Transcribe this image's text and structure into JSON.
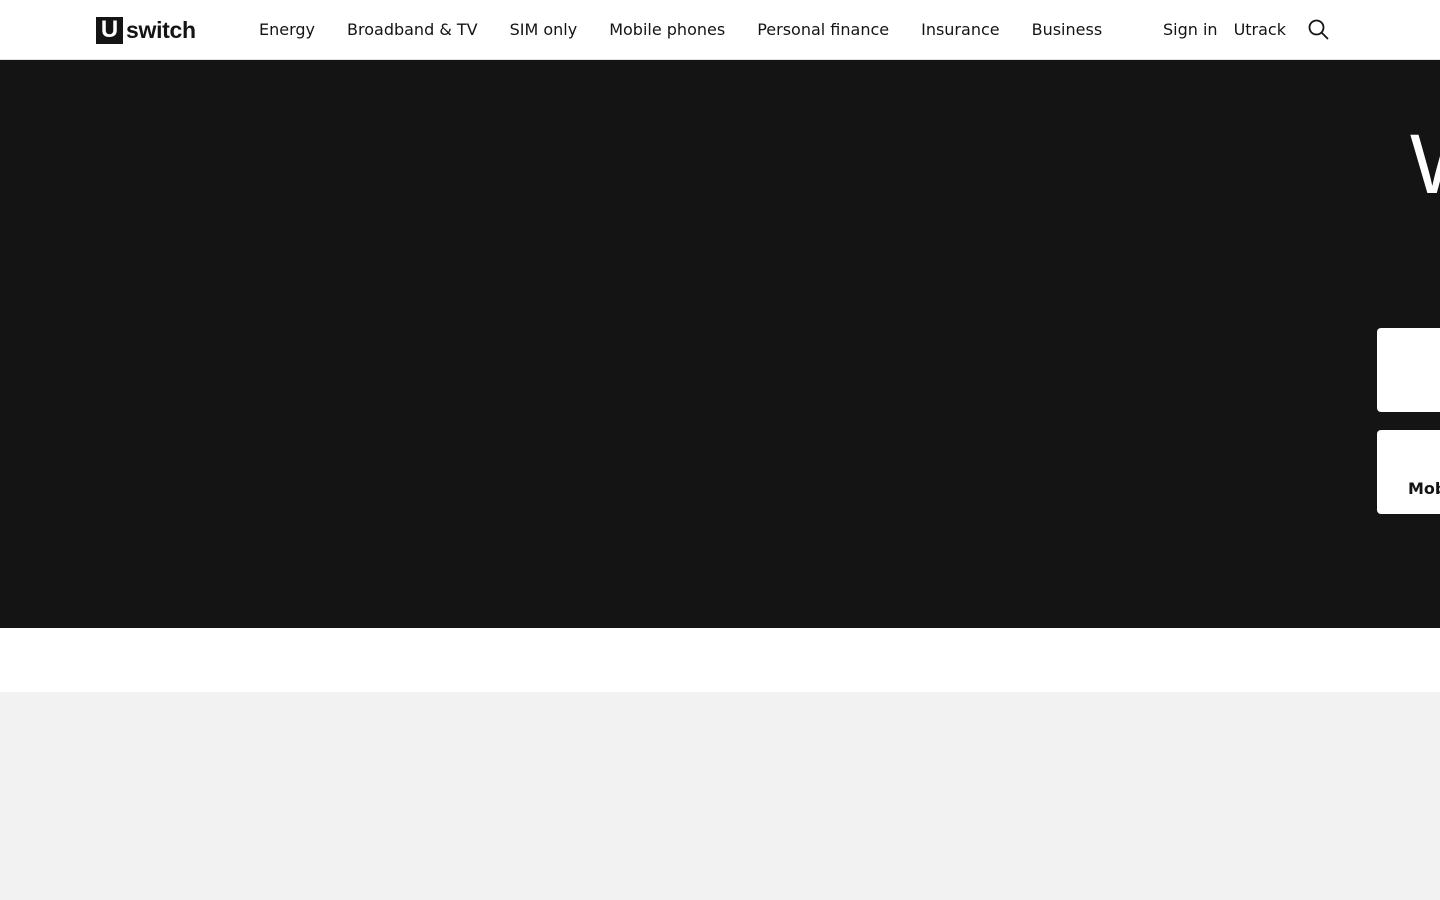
{
  "header": {
    "logo": {
      "mark": "U",
      "word": "switch"
    },
    "nav": [
      {
        "label": "Energy"
      },
      {
        "label": "Broadband & TV"
      },
      {
        "label": "SIM only"
      },
      {
        "label": "Mobile phones"
      },
      {
        "label": "Personal finance"
      },
      {
        "label": "Insurance"
      },
      {
        "label": "Business"
      }
    ],
    "utility": {
      "sign_in": "Sign in",
      "utrack": "Utrack",
      "search_icon": "search-icon"
    }
  },
  "hero": {
    "title_fragment": "W",
    "cards": [
      {
        "label": ""
      },
      {
        "label": "Mob"
      }
    ]
  },
  "colors": {
    "hero_bg": "#141414",
    "header_bg": "#ffffff",
    "page_bg": "#f2f2f2",
    "text": "#141414"
  }
}
